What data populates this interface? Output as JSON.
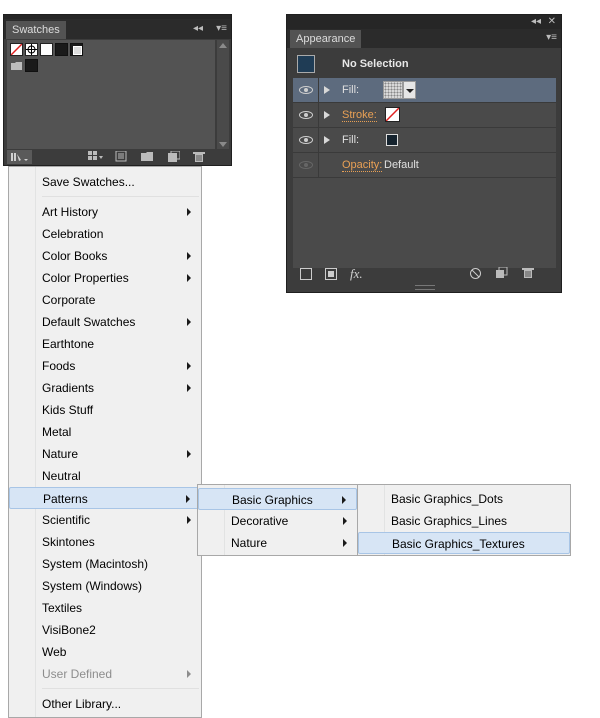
{
  "swatches_panel": {
    "title": "Swatches",
    "collapse_glyph": "◂◂",
    "menu_glyph": "▾≡"
  },
  "appearance_panel": {
    "title": "Appearance",
    "collapse_glyph": "◂◂",
    "close_glyph": "✕",
    "menu_glyph": "▾≡",
    "selection_label": "No Selection",
    "rows": [
      {
        "label": "Fill:",
        "kind": "fill-pattern"
      },
      {
        "label": "Stroke:",
        "kind": "stroke-none"
      },
      {
        "label": "Fill:",
        "kind": "fill-dark"
      },
      {
        "label": "Opacity:",
        "value": "Default"
      }
    ],
    "fx_label": "fx."
  },
  "library_menu": {
    "items": [
      {
        "label": "Save Swatches...",
        "submenu": false
      },
      {
        "label": "Art History",
        "submenu": true
      },
      {
        "label": "Celebration",
        "submenu": false
      },
      {
        "label": "Color Books",
        "submenu": true
      },
      {
        "label": "Color Properties",
        "submenu": true
      },
      {
        "label": "Corporate",
        "submenu": false
      },
      {
        "label": "Default Swatches",
        "submenu": true
      },
      {
        "label": "Earthtone",
        "submenu": false
      },
      {
        "label": "Foods",
        "submenu": true
      },
      {
        "label": "Gradients",
        "submenu": true
      },
      {
        "label": "Kids Stuff",
        "submenu": false
      },
      {
        "label": "Metal",
        "submenu": false
      },
      {
        "label": "Nature",
        "submenu": true
      },
      {
        "label": "Neutral",
        "submenu": false
      },
      {
        "label": "Patterns",
        "submenu": true,
        "highlighted": true
      },
      {
        "label": "Scientific",
        "submenu": true
      },
      {
        "label": "Skintones",
        "submenu": false
      },
      {
        "label": "System (Macintosh)",
        "submenu": false
      },
      {
        "label": "System (Windows)",
        "submenu": false
      },
      {
        "label": "Textiles",
        "submenu": false
      },
      {
        "label": "VisiBone2",
        "submenu": false
      },
      {
        "label": "Web",
        "submenu": false
      },
      {
        "label": "User Defined",
        "submenu": true,
        "disabled": true
      },
      {
        "label": "Other Library...",
        "submenu": false
      }
    ]
  },
  "patterns_menu": {
    "items": [
      {
        "label": "Basic Graphics",
        "submenu": true,
        "highlighted": true
      },
      {
        "label": "Decorative",
        "submenu": true
      },
      {
        "label": "Nature",
        "submenu": true
      }
    ]
  },
  "basic_graphics_menu": {
    "items": [
      {
        "label": "Basic Graphics_Dots"
      },
      {
        "label": "Basic Graphics_Lines"
      },
      {
        "label": "Basic Graphics_Textures",
        "highlighted": true
      }
    ]
  },
  "colors": {
    "panel_bg": "#3c3c3c",
    "panel_content": "#535353",
    "menu_bg": "#f0f0f0",
    "menu_highlight": "#d7e5f5",
    "selected_row": "#5d6b7e",
    "accent_orange": "#e8a055"
  }
}
